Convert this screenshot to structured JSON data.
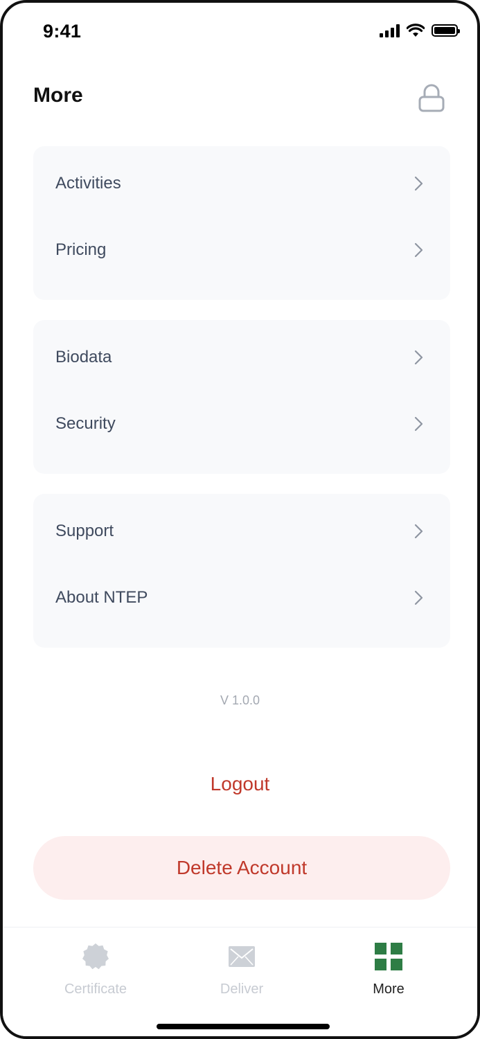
{
  "status_bar": {
    "time": "9:41"
  },
  "header": {
    "title": "More",
    "lock_icon": "lock-icon"
  },
  "menu_groups": [
    {
      "items": [
        {
          "label": "Activities"
        },
        {
          "label": "Pricing"
        }
      ]
    },
    {
      "items": [
        {
          "label": "Biodata"
        },
        {
          "label": "Security"
        }
      ]
    },
    {
      "items": [
        {
          "label": "Support"
        },
        {
          "label": "About NTEP"
        }
      ]
    }
  ],
  "version": "V 1.0.0",
  "actions": {
    "logout": "Logout",
    "delete_account": "Delete Account"
  },
  "bottom_nav": [
    {
      "label": "Certificate",
      "icon": "badge-icon",
      "active": false
    },
    {
      "label": "Deliver",
      "icon": "envelope-icon",
      "active": false
    },
    {
      "label": "More",
      "icon": "grid-icon",
      "active": true
    }
  ],
  "colors": {
    "accent_green": "#2e7d45",
    "danger_red": "#c0392b",
    "danger_bg": "#fdeeee",
    "card_bg": "#f8f9fb",
    "label_text": "#3f4a5e",
    "inactive_icon": "#c7cbd2"
  }
}
